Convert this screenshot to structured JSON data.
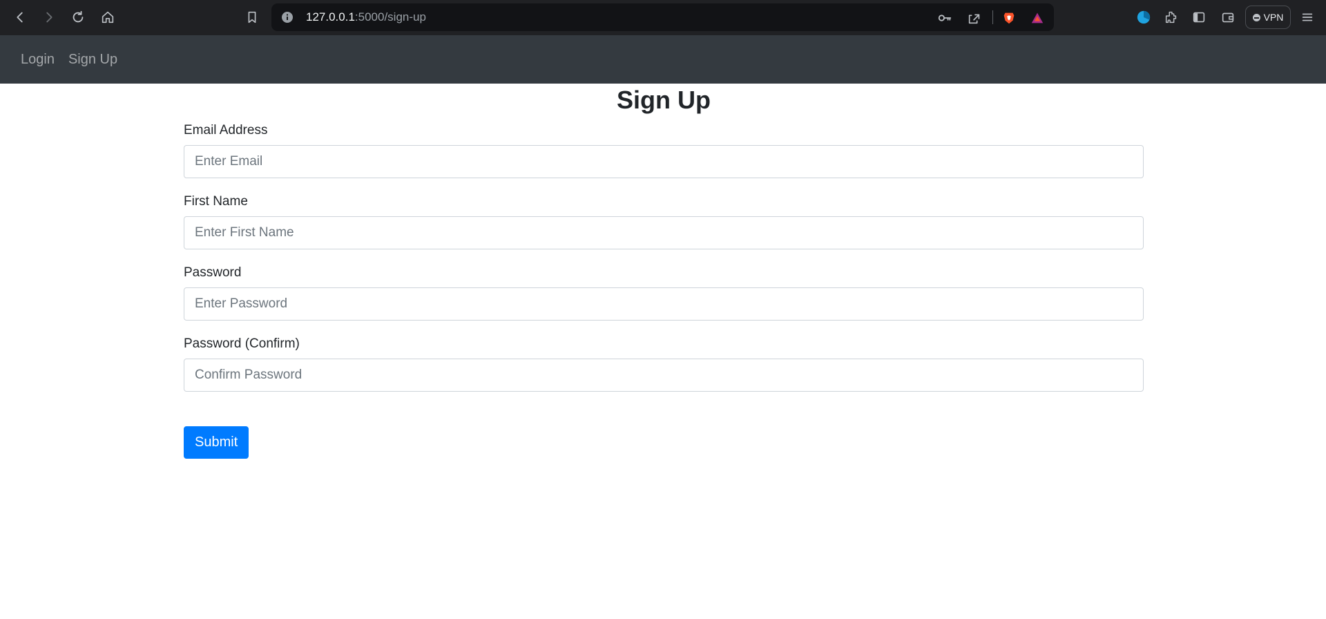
{
  "browser": {
    "url_host": "127.0.0.1",
    "url_rest": ":5000/sign-up",
    "vpn_label": "VPN"
  },
  "navbar": {
    "links": [
      {
        "label": "Login"
      },
      {
        "label": "Sign Up"
      }
    ]
  },
  "form": {
    "title": "Sign Up",
    "fields": [
      {
        "label": "Email Address",
        "placeholder": "Enter Email",
        "value": ""
      },
      {
        "label": "First Name",
        "placeholder": "Enter First Name",
        "value": ""
      },
      {
        "label": "Password",
        "placeholder": "Enter Password",
        "value": ""
      },
      {
        "label": "Password (Confirm)",
        "placeholder": "Confirm Password",
        "value": ""
      }
    ],
    "submit_label": "Submit"
  },
  "colors": {
    "chrome_bg": "#202124",
    "navbar_bg": "#343a40",
    "primary": "#007bff"
  }
}
